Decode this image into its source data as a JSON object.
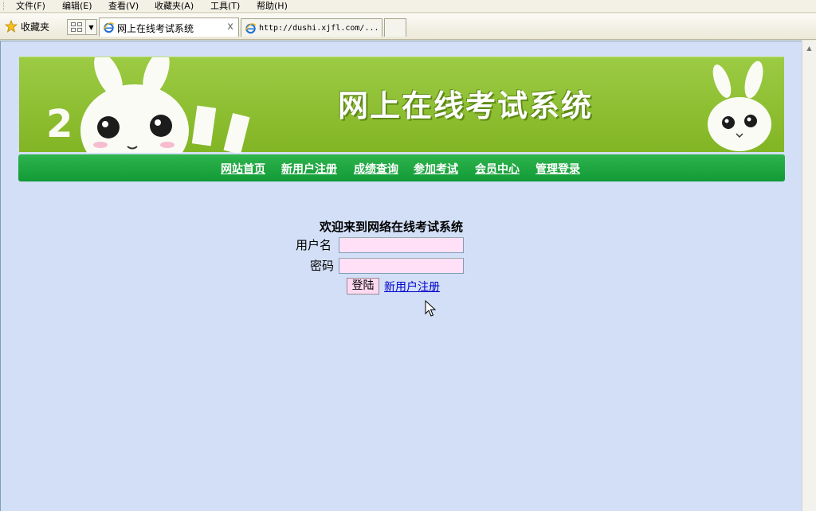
{
  "menubar": {
    "items": [
      "文件(F)",
      "编辑(E)",
      "查看(V)",
      "收藏夹(A)",
      "工具(T)",
      "帮助(H)"
    ]
  },
  "toolbar": {
    "favorites_label": "收藏夹",
    "tabs": [
      {
        "label": "网上在线考试系统",
        "active": true
      },
      {
        "label": "http://dushi.xjfl.com/...",
        "active": false
      }
    ],
    "close_glyph": "x"
  },
  "banner": {
    "title": "网上在线考试系统",
    "decoration_text": "2"
  },
  "nav": {
    "items": [
      "网站首页",
      "新用户注册",
      "成绩查询",
      "参加考试",
      "会员中心",
      "管理登录"
    ]
  },
  "login": {
    "welcome": "欢迎来到网络在线考试系统",
    "username_label": "用户名",
    "username_value": "",
    "password_label": "密码",
    "password_value": "",
    "submit_label": "登陆",
    "register_link": "新用户注册"
  },
  "colors": {
    "content_bg": "#d2dff6",
    "banner_green": "#8bbd2b",
    "nav_green": "#1aa33d",
    "input_bg": "#ffe0f7",
    "link": "#0000cc"
  }
}
